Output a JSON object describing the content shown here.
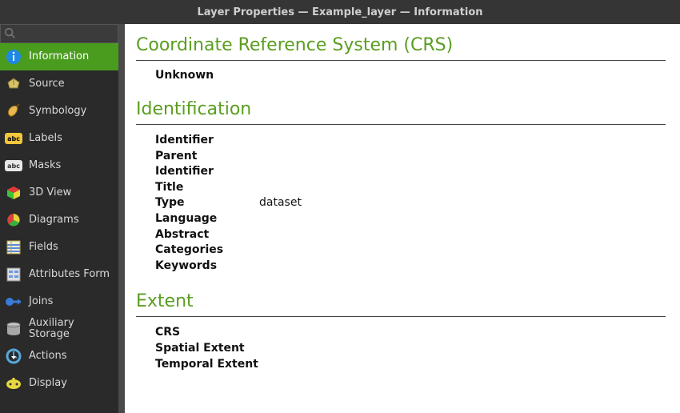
{
  "titlebar": "Layer Properties — Example_layer — Information",
  "sidebar": {
    "search_placeholder": "",
    "items": [
      {
        "label": "Information",
        "icon": "info",
        "active": true
      },
      {
        "label": "Source",
        "icon": "source",
        "active": false
      },
      {
        "label": "Symbology",
        "icon": "symbology",
        "active": false
      },
      {
        "label": "Labels",
        "icon": "labels",
        "active": false
      },
      {
        "label": "Masks",
        "icon": "masks",
        "active": false
      },
      {
        "label": "3D View",
        "icon": "3dview",
        "active": false
      },
      {
        "label": "Diagrams",
        "icon": "diagrams",
        "active": false
      },
      {
        "label": "Fields",
        "icon": "fields",
        "active": false
      },
      {
        "label": "Attributes Form",
        "icon": "attrform",
        "active": false
      },
      {
        "label": "Joins",
        "icon": "joins",
        "active": false
      },
      {
        "label": "Auxiliary Storage",
        "icon": "auxstorage",
        "active": false
      },
      {
        "label": "Actions",
        "icon": "actions",
        "active": false
      },
      {
        "label": "Display",
        "icon": "display",
        "active": false
      }
    ]
  },
  "sections": {
    "crs": {
      "title": "Coordinate Reference System (CRS)",
      "value": "Unknown"
    },
    "identification": {
      "title": "Identification",
      "rows": [
        {
          "k": "Identifier",
          "v": ""
        },
        {
          "k": "Parent Identifier",
          "v": ""
        },
        {
          "k": "Title",
          "v": ""
        },
        {
          "k": "Type",
          "v": "dataset"
        },
        {
          "k": "Language",
          "v": ""
        },
        {
          "k": "Abstract",
          "v": ""
        },
        {
          "k": "Categories",
          "v": ""
        },
        {
          "k": "Keywords",
          "v": ""
        }
      ]
    },
    "extent": {
      "title": "Extent",
      "rows": [
        {
          "k": "CRS",
          "v": ""
        },
        {
          "k": "Spatial Extent",
          "v": ""
        },
        {
          "k": "Temporal Extent",
          "v": ""
        }
      ]
    }
  }
}
